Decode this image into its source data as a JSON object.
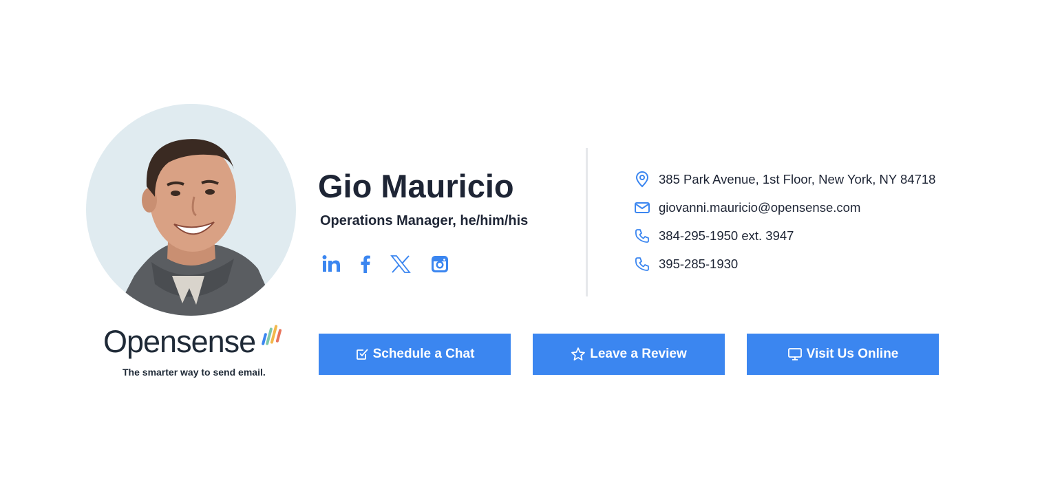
{
  "signature": {
    "name": "Gio Mauricio",
    "title": "Operations Manager, he/him/his"
  },
  "logo": {
    "wordmark": "Opensense",
    "tagline": "The smarter way to send email.",
    "bar_colors": [
      "#3b86f0",
      "#7fc8a9",
      "#f2b84b",
      "#e8745c"
    ]
  },
  "socials": [
    {
      "icon": "linkedin-icon"
    },
    {
      "icon": "facebook-icon"
    },
    {
      "icon": "x-twitter-icon"
    },
    {
      "icon": "instagram-icon"
    }
  ],
  "contact": {
    "address": "385 Park Avenue, 1st Floor, New York, NY 84718",
    "email": "giovanni.mauricio@opensense.com",
    "phone_office": "384-295-1950 ext. 3947",
    "phone_mobile": "395-285-1930"
  },
  "buttons": {
    "schedule": "Schedule a Chat",
    "review": "Leave a Review",
    "visit": "Visit Us Online"
  },
  "colors": {
    "accent": "#3b86f0",
    "text": "#1e2535",
    "avatar_bg": "#e0ebf0"
  }
}
